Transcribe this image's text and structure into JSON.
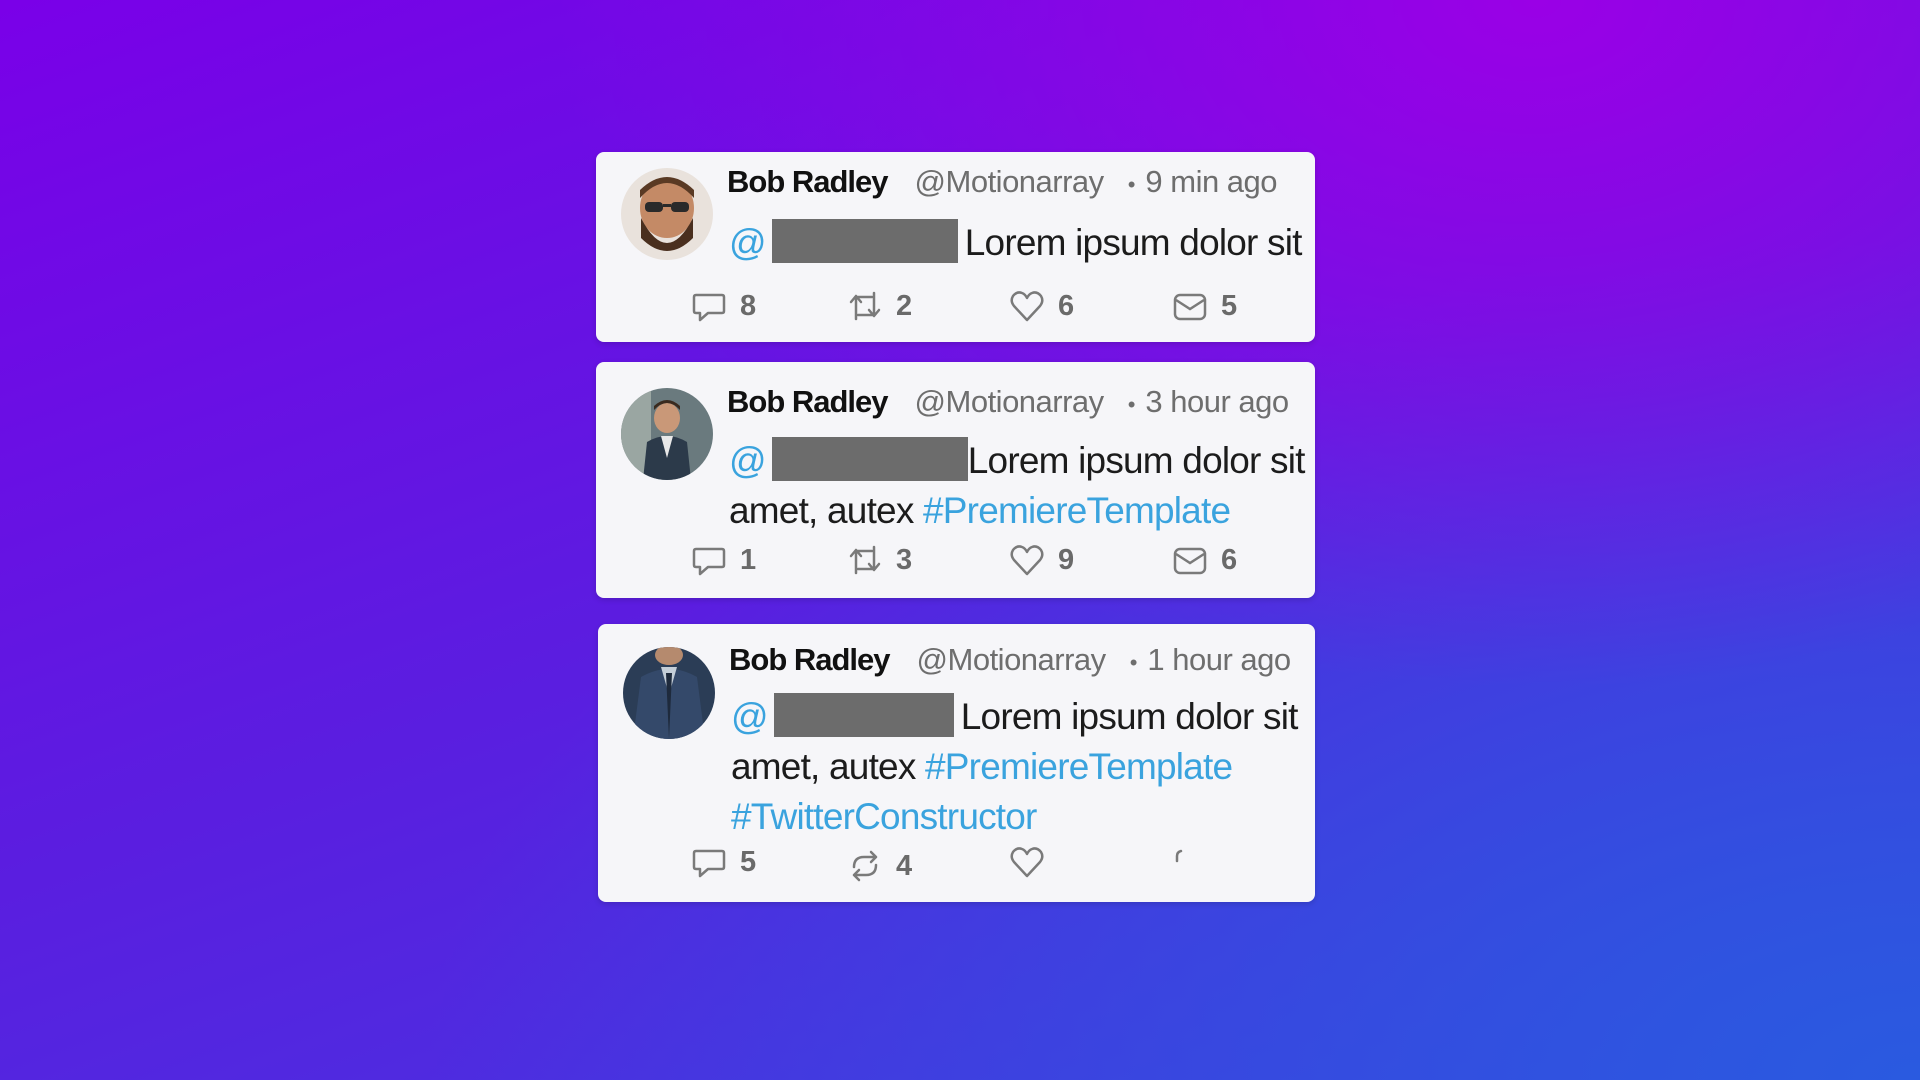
{
  "tweets": [
    {
      "name": "Bob Radley",
      "handle": "@Motionarray",
      "dot": "•",
      "time": "9 min ago",
      "mention": "@",
      "line1": "Lorem ipsum dolor sit",
      "line2_text": "",
      "line2_tag": "",
      "line3_tag": "",
      "counts": {
        "reply": "8",
        "retweet": "2",
        "like": "6",
        "mail": "5"
      }
    },
    {
      "name": "Bob Radley",
      "handle": "@Motionarray",
      "dot": "•",
      "time": "3 hour ago",
      "mention": "@",
      "line1": "Lorem ipsum dolor sit",
      "line2_text": "amet, autex ",
      "line2_tag": "#PremiereTemplate",
      "line3_tag": "",
      "counts": {
        "reply": "1",
        "retweet": "3",
        "like": "9",
        "mail": "6"
      }
    },
    {
      "name": "Bob Radley",
      "handle": "@Motionarray",
      "dot": "•",
      "time": "1 hour ago",
      "mention": "@",
      "line1": "Lorem ipsum dolor sit",
      "line2_text": "amet, autex ",
      "line2_tag": "#PremiereTemplate",
      "line3_tag": "#TwitterConstructor",
      "counts": {
        "reply": "5",
        "retweet": "4",
        "like": "",
        "mail": ""
      }
    }
  ],
  "colors": {
    "accent": "#3aa3de",
    "name": "#111111",
    "meta": "#6e6e6e",
    "redaction": "#6c6c6c"
  },
  "icons": [
    "reply-icon",
    "retweet-icon",
    "like-icon",
    "mail-icon"
  ]
}
